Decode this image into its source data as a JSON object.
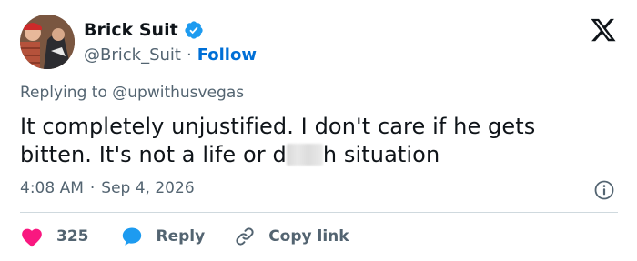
{
  "author": {
    "display_name": "Brick Suit",
    "handle": "@Brick_Suit",
    "separator": "·",
    "follow_label": "Follow",
    "verified_color": "#1d9bf0"
  },
  "reply_context": {
    "prefix": "Replying to",
    "mention": "@upwithusvegas"
  },
  "tweet": {
    "text_line1": "It completely unjustified. I don't care if he gets",
    "text_line2_before": "bitten. It's not a life or d",
    "text_line2_after": "h situation"
  },
  "meta": {
    "time": "4:08 AM",
    "separator": "·",
    "date": "Sep 4, 2026"
  },
  "actions": {
    "like_count": "325",
    "reply_label": "Reply",
    "copy_label": "Copy link",
    "like_color": "#f91880",
    "reply_color": "#1d9bf0"
  },
  "icons": {
    "brand": "x-logo-icon",
    "info": "info-icon",
    "like": "heart-icon",
    "reply": "reply-bubble-icon",
    "copy": "link-icon",
    "verified": "verified-badge-icon"
  }
}
